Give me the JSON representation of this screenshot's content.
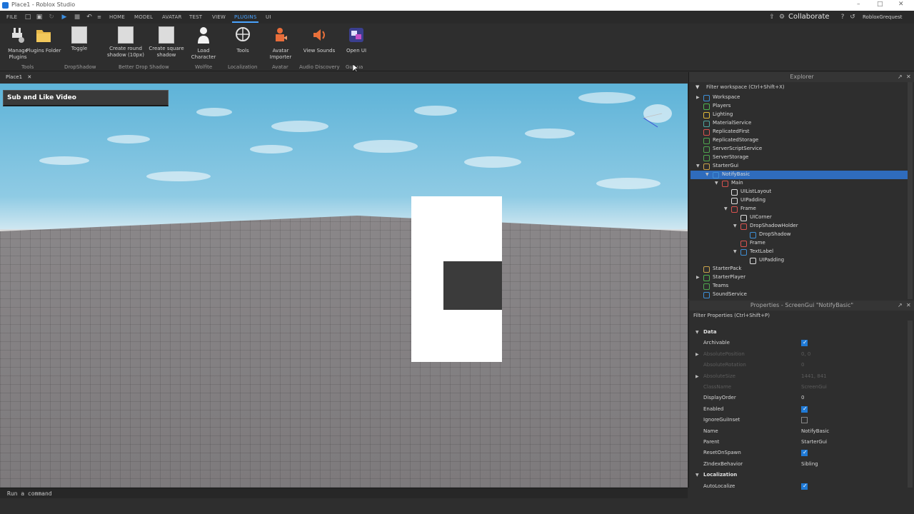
{
  "window": {
    "title": "Place1 - Roblox Studio"
  },
  "menubar": {
    "items": [
      "FILE",
      "HOME",
      "MODEL",
      "AVATAR",
      "TEST",
      "VIEW",
      "PLUGINS",
      "UI"
    ],
    "active": "PLUGINS",
    "collaborate_label": "Collaborate",
    "username": "RobloxGrequest"
  },
  "ribbon": {
    "buttons": [
      {
        "label": "Manage Plugins",
        "icon": "plugin-gear-icon"
      },
      {
        "label": "Plugins Folder",
        "icon": "folder-icon"
      },
      {
        "label": "Toggle",
        "icon": "toggle-icon"
      },
      {
        "label": "Create round shadow (10px)",
        "icon": "round-shadow-icon"
      },
      {
        "label": "Create square shadow",
        "icon": "square-shadow-icon"
      },
      {
        "label": "Load Character",
        "icon": "character-icon"
      },
      {
        "label": "Tools",
        "icon": "globe-tools-icon"
      },
      {
        "label": "Avatar Importer",
        "icon": "avatar-importer-icon"
      },
      {
        "label": "View Sounds",
        "icon": "sound-icon"
      },
      {
        "label": "Open UI",
        "icon": "open-ui-icon"
      }
    ],
    "groups": [
      "Tools",
      "DropShadow",
      "Better Drop Shadow",
      "Wolfite",
      "Localization",
      "Avatar",
      "Audio Discovery",
      "GuiLua"
    ]
  },
  "doc_tab": {
    "label": "Place1"
  },
  "viewport": {
    "banner_text": "Sub and Like Video"
  },
  "command_bar": {
    "placeholder": "Run a command"
  },
  "explorer": {
    "title": "Explorer",
    "filter_placeholder": "Filter workspace (Ctrl+Shift+X)",
    "items": [
      {
        "label": "Workspace",
        "depth": 0,
        "arrow": "right",
        "icon": "workspace-icon",
        "color": "#3e8fd6"
      },
      {
        "label": "Players",
        "depth": 0,
        "arrow": "",
        "icon": "players-icon",
        "color": "#4fb34f"
      },
      {
        "label": "Lighting",
        "depth": 0,
        "arrow": "",
        "icon": "lighting-icon",
        "color": "#e0b83a"
      },
      {
        "label": "MaterialService",
        "depth": 0,
        "arrow": "",
        "icon": "material-service-icon",
        "color": "#4fa6a0"
      },
      {
        "label": "ReplicatedFirst",
        "depth": 0,
        "arrow": "",
        "icon": "replicated-first-icon",
        "color": "#d9534f"
      },
      {
        "label": "ReplicatedStorage",
        "depth": 0,
        "arrow": "",
        "icon": "replicated-storage-icon",
        "color": "#4fa64f"
      },
      {
        "label": "ServerScriptService",
        "depth": 0,
        "arrow": "",
        "icon": "server-script-service-icon",
        "color": "#4fa64f"
      },
      {
        "label": "ServerStorage",
        "depth": 0,
        "arrow": "",
        "icon": "server-storage-icon",
        "color": "#4fa64f"
      },
      {
        "label": "StarterGui",
        "depth": 0,
        "arrow": "down",
        "icon": "starter-gui-icon",
        "color": "#c9a34b"
      },
      {
        "label": "NotifyBasic",
        "depth": 1,
        "arrow": "down",
        "icon": "screen-gui-icon",
        "color": "#3e8fd6",
        "selected": true
      },
      {
        "label": "Main",
        "depth": 2,
        "arrow": "down",
        "icon": "frame-icon",
        "color": "#d9534f"
      },
      {
        "label": "UIListLayout",
        "depth": 3,
        "arrow": "",
        "icon": "list-layout-icon",
        "color": "#e0e0e0"
      },
      {
        "label": "UIPadding",
        "depth": 3,
        "arrow": "",
        "icon": "padding-icon",
        "color": "#e0e0e0"
      },
      {
        "label": "Frame",
        "depth": 3,
        "arrow": "down",
        "icon": "frame-icon",
        "color": "#d9534f"
      },
      {
        "label": "UICorner",
        "depth": 4,
        "arrow": "",
        "icon": "corner-icon",
        "color": "#e0e0e0"
      },
      {
        "label": "DropShadowHolder",
        "depth": 4,
        "arrow": "down",
        "icon": "frame-icon",
        "color": "#d9534f"
      },
      {
        "label": "DropShadow",
        "depth": 5,
        "arrow": "",
        "icon": "image-label-icon",
        "color": "#3e8fd6"
      },
      {
        "label": "Frame",
        "depth": 4,
        "arrow": "",
        "icon": "frame-icon",
        "color": "#d9534f"
      },
      {
        "label": "TextLabel",
        "depth": 4,
        "arrow": "down",
        "icon": "text-label-icon",
        "color": "#3e8fd6"
      },
      {
        "label": "UIPadding",
        "depth": 5,
        "arrow": "",
        "icon": "padding-icon",
        "color": "#e0e0e0"
      },
      {
        "label": "StarterPack",
        "depth": 0,
        "arrow": "",
        "icon": "starter-pack-icon",
        "color": "#c9a34b"
      },
      {
        "label": "StarterPlayer",
        "depth": 0,
        "arrow": "right",
        "icon": "starter-player-icon",
        "color": "#4fb34f"
      },
      {
        "label": "Teams",
        "depth": 0,
        "arrow": "",
        "icon": "teams-icon",
        "color": "#4fa64f"
      },
      {
        "label": "SoundService",
        "depth": 0,
        "arrow": "",
        "icon": "sound-service-icon",
        "color": "#3e8fd6"
      }
    ]
  },
  "properties": {
    "title": "Properties - ScreenGui \"NotifyBasic\"",
    "filter_placeholder": "Filter Properties (Ctrl+Shift+P)",
    "rows": [
      {
        "type": "category",
        "name": "Data"
      },
      {
        "type": "bool",
        "name": "Archivable",
        "value": true
      },
      {
        "type": "text",
        "name": "AbsolutePosition",
        "value": "0, 0",
        "dim": true,
        "arrow": true
      },
      {
        "type": "text",
        "name": "AbsoluteRotation",
        "value": "0",
        "dim": true
      },
      {
        "type": "text",
        "name": "AbsoluteSize",
        "value": "1441, 841",
        "dim": true,
        "arrow": true
      },
      {
        "type": "text",
        "name": "ClassName",
        "value": "ScreenGui",
        "dim": true
      },
      {
        "type": "text",
        "name": "DisplayOrder",
        "value": "0"
      },
      {
        "type": "bool",
        "name": "Enabled",
        "value": true
      },
      {
        "type": "bool",
        "name": "IgnoreGuiInset",
        "value": false
      },
      {
        "type": "text",
        "name": "Name",
        "value": "NotifyBasic"
      },
      {
        "type": "text",
        "name": "Parent",
        "value": "StarterGui"
      },
      {
        "type": "bool",
        "name": "ResetOnSpawn",
        "value": true
      },
      {
        "type": "text",
        "name": "ZIndexBehavior",
        "value": "Sibling"
      },
      {
        "type": "category",
        "name": "Localization"
      },
      {
        "type": "bool",
        "name": "AutoLocalize",
        "value": true
      }
    ]
  }
}
